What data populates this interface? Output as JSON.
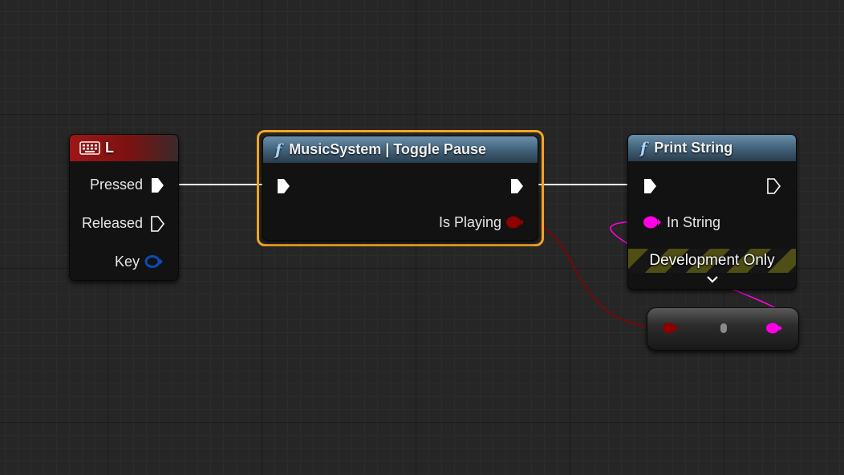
{
  "nodes": {
    "key_event": {
      "title": "L",
      "icon": "keyboard-icon",
      "header_color": "#9e1616",
      "pins": {
        "pressed": "Pressed",
        "released": "Released",
        "key": "Key"
      }
    },
    "toggle_pause": {
      "title": "MusicSystem | Toggle Pause",
      "icon": "function-icon",
      "glyph": "f",
      "selected": true,
      "selection_color": "#f5a623",
      "pins": {
        "is_playing": "Is Playing"
      }
    },
    "print_string": {
      "title": "Print String",
      "icon": "function-icon",
      "glyph": "f",
      "pins": {
        "in_string": "In String"
      },
      "banner": "Development Only",
      "expand_icon": "chevron-down-icon"
    },
    "conversion": {
      "type": "bool-to-string-conversion",
      "input_color": "#8c0000",
      "output_color": "#ff00e6"
    }
  },
  "pin_colors": {
    "exec": "#ffffff",
    "bool": "#8c0000",
    "string": "#ff00e6",
    "struct_key": "#0a4cb6"
  },
  "colors": {
    "background": "#262626",
    "exec_wire": "#ffffff",
    "bool_wire": "#8c0000",
    "string_wire": "#ff00e6"
  }
}
